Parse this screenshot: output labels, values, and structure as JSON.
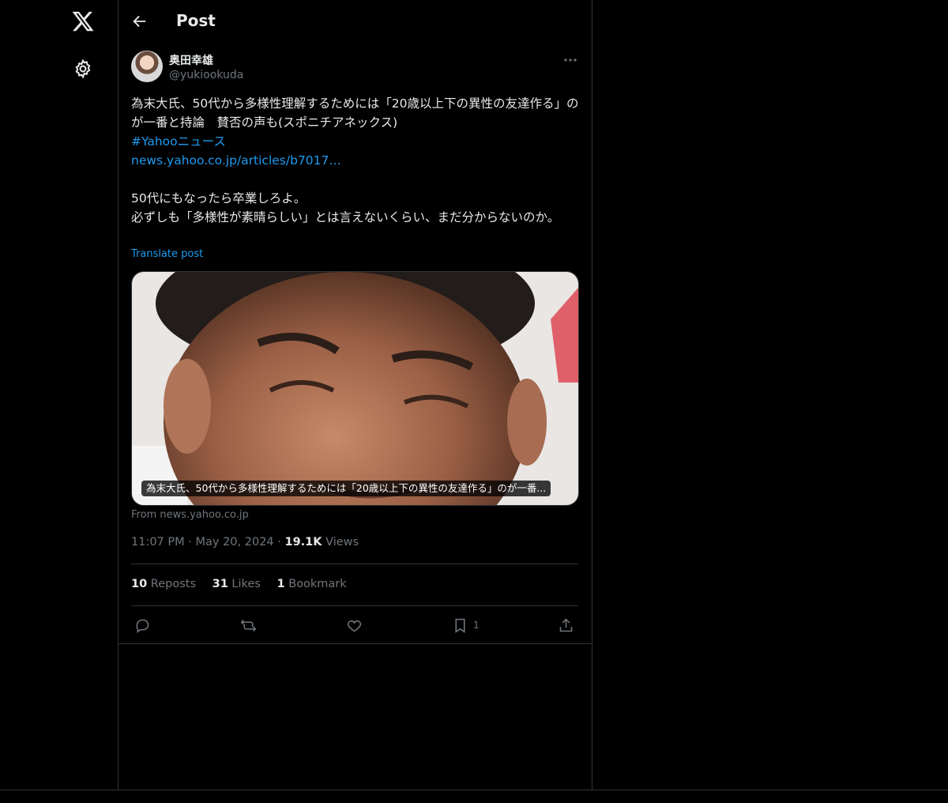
{
  "nav": {
    "logo_icon": "x-logo-icon",
    "settings_icon": "gear-icon"
  },
  "header": {
    "title": "Post",
    "back_icon": "arrow-left-icon"
  },
  "post": {
    "author_name": "奥田幸雄",
    "author_handle": "@yukiookuda",
    "body_line1": "為末大氏、50代から多様性理解するためには「20歳以上下の異性の友達作る」のが一番と持論　賛否の声も(スポニチアネックス)",
    "hashtag": "#Yahooニュース",
    "link_text": "news.yahoo.co.jp/articles/b7017…",
    "comment_line1": "50代にもなったら卒業しろよ。",
    "comment_line2": "必ずしも「多様性が素晴らしい」とは言えないくらい、まだ分からないのか。",
    "translate_label": "Translate post",
    "card_caption": "為末大氏、50代から多様性理解するためには「20歳以上下の異性の友達作る」のが一番...",
    "card_source": "From news.yahoo.co.jp",
    "time": "11:07 PM",
    "date": "May 20, 2024",
    "views_count": "19.1K",
    "views_label": "Views",
    "reposts_count": "10",
    "reposts_label": "Reposts",
    "likes_count": "31",
    "likes_label": "Likes",
    "bookmarks_count": "1",
    "bookmarks_label": "Bookmark",
    "bookmark_action_count": "1"
  },
  "colors": {
    "background": "#000000",
    "text": "#e7e9ea",
    "muted": "#71767b",
    "accent": "#1d9bf0",
    "border": "#2f3336"
  }
}
